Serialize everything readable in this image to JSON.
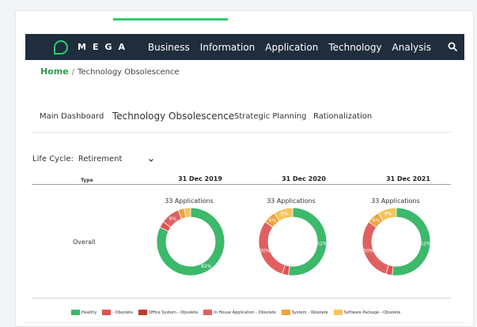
{
  "brand": {
    "name": "MEGA",
    "accent": "#2ecc71",
    "navbar_color": "#1f2d3d"
  },
  "nav": {
    "items": [
      "Business",
      "Information",
      "Application",
      "Technology",
      "Analysis"
    ],
    "search_icon": "search-icon"
  },
  "breadcrumb": {
    "home": "Home",
    "separator": "/",
    "current": "Technology Obsolescence"
  },
  "tabs": {
    "items": [
      "Main Dashboard",
      "Technology Obsolescence",
      "Strategic Planning",
      "Rationalization"
    ],
    "active_index": 1
  },
  "filter": {
    "label": "Life Cycle:",
    "value": "Retirement",
    "chevron_icon": "chevron-down-icon"
  },
  "table": {
    "type_header": "Type",
    "row_label": "Overall",
    "columns": [
      {
        "date": "31 Dec 2019",
        "apps": "33 Applications"
      },
      {
        "date": "31 Dec 2020",
        "apps": "33 Applications"
      },
      {
        "date": "31 Dec 2021",
        "apps": "33 Applications"
      }
    ]
  },
  "chart_data": [
    {
      "type": "pie",
      "title": "31 Dec 2019",
      "subtitle": "33 Applications",
      "slices": [
        {
          "label": "Healthy",
          "value": 82,
          "display": "82%",
          "color": "#3cb96b"
        },
        {
          "label": "- Obsolete",
          "value": 3,
          "display": "",
          "color": "#e05252"
        },
        {
          "label": "Office System - Obsolete",
          "value": 0,
          "display": "",
          "color": "#c0392b"
        },
        {
          "label": "In House Application - Obsolete",
          "value": 9,
          "display": "9%",
          "color": "#e06060"
        },
        {
          "label": "System - Obsolete",
          "value": 3,
          "display": "",
          "color": "#f0a23b"
        },
        {
          "label": "Software Package - Obsolete",
          "value": 3,
          "display": "",
          "color": "#f5c45a"
        }
      ]
    },
    {
      "type": "pie",
      "title": "31 Dec 2020",
      "subtitle": "33 Applications",
      "slices": [
        {
          "label": "Healthy",
          "value": 52,
          "display": "52%",
          "color": "#3cb96b"
        },
        {
          "label": "- Obsolete",
          "value": 3,
          "display": "",
          "color": "#e05252"
        },
        {
          "label": "Office System - Obsolete",
          "value": 0,
          "display": "",
          "color": "#c0392b"
        },
        {
          "label": "In House Application - Obsolete",
          "value": 30,
          "display": "30%",
          "color": "#e06060"
        },
        {
          "label": "System - Obsolete",
          "value": 6,
          "display": "6%",
          "color": "#f0a23b"
        },
        {
          "label": "Software Package - Obsolete",
          "value": 9,
          "display": "9%",
          "color": "#f5c45a"
        }
      ]
    },
    {
      "type": "pie",
      "title": "31 Dec 2021",
      "subtitle": "33 Applications",
      "slices": [
        {
          "label": "Healthy",
          "value": 52,
          "display": "52%",
          "color": "#3cb96b"
        },
        {
          "label": "- Obsolete",
          "value": 3,
          "display": "",
          "color": "#e05252"
        },
        {
          "label": "Office System - Obsolete",
          "value": 0,
          "display": "",
          "color": "#c0392b"
        },
        {
          "label": "In House Application - Obsolete",
          "value": 30,
          "display": "30%",
          "color": "#e06060"
        },
        {
          "label": "System - Obsolete",
          "value": 6,
          "display": "6%",
          "color": "#f0a23b"
        },
        {
          "label": "Software Package - Obsolete",
          "value": 9,
          "display": "9%",
          "color": "#f5c45a"
        }
      ]
    }
  ],
  "legend": [
    {
      "label": "Healthy",
      "color": "#3cb96b"
    },
    {
      "label": "- Obsolete",
      "color": "#e05252"
    },
    {
      "label": "Office System - Obsolete",
      "color": "#c0392b"
    },
    {
      "label": "In House Application - Obsolete",
      "color": "#e06060"
    },
    {
      "label": "System - Obsolete",
      "color": "#f0a23b"
    },
    {
      "label": "Software Package - Obsolete",
      "color": "#f5c45a"
    }
  ]
}
